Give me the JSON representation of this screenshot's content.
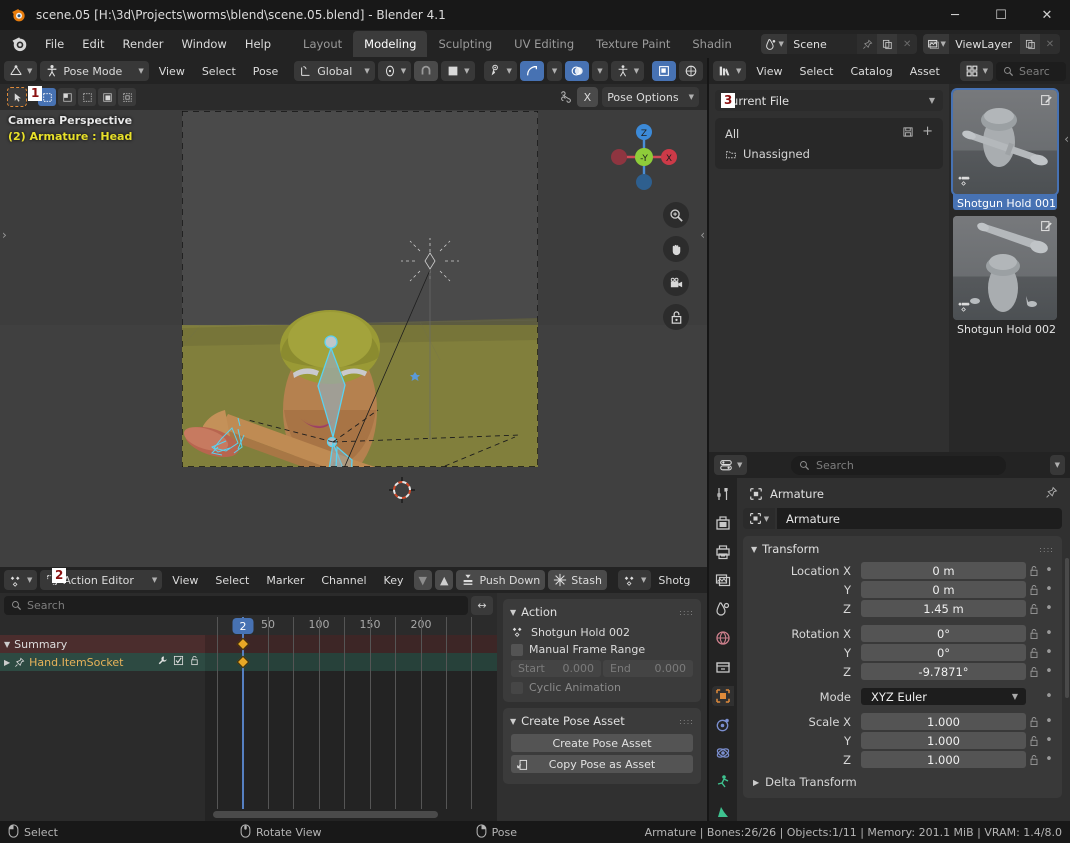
{
  "window": {
    "title": "scene.05 [H:\\3d\\Projects\\worms\\blend\\scene.05.blend] - Blender 4.1",
    "minimize": "─",
    "maximize": "☐",
    "close": "✕"
  },
  "menubar": {
    "items": [
      "File",
      "Edit",
      "Render",
      "Window",
      "Help"
    ],
    "workspaces": [
      {
        "label": "Layout",
        "active": false
      },
      {
        "label": "Modeling",
        "active": true
      },
      {
        "label": "Sculpting",
        "active": false
      },
      {
        "label": "UV Editing",
        "active": false
      },
      {
        "label": "Texture Paint",
        "active": false
      },
      {
        "label": "Shadin",
        "active": false
      }
    ],
    "scene_name": "Scene",
    "viewlayer_name": "ViewLayer"
  },
  "viewport": {
    "mode": "Pose Mode",
    "menus": [
      "View",
      "Select",
      "Pose"
    ],
    "transform_orientation": "Global",
    "pose_options": "Pose Options",
    "x_button": "X",
    "overlay_line1": "Camera Perspective",
    "overlay_line2": "(2) Armature : Head",
    "gizmo_axes": [
      "Z",
      "-Y",
      "X"
    ],
    "marker_1": "1"
  },
  "dopesheet": {
    "editor_mode": "Action Editor",
    "menus": [
      "View",
      "Select",
      "Marker",
      "Channel",
      "Key"
    ],
    "push_down": "Push Down",
    "stash": "Stash",
    "action_name_truncated": "Shotg",
    "search_placeholder": "Search",
    "ruler_ticks": [
      "50",
      "100",
      "150",
      "200"
    ],
    "current_frame": "2",
    "channels": [
      {
        "name": "Summary",
        "type": "summary"
      },
      {
        "name": "Hand.ItemSocket",
        "type": "channel"
      }
    ],
    "marker_2": "2",
    "sidebar": {
      "action_panel_title": "Action",
      "action_name": "Shotgun Hold 002",
      "manual_frame_range": "Manual Frame Range",
      "start_label": "Start",
      "start_value": "0.000",
      "end_label": "End",
      "end_value": "0.000",
      "cyclic_animation": "Cyclic Animation",
      "create_pose_asset_title": "Create Pose Asset",
      "create_pose_asset_button": "Create Pose Asset",
      "copy_pose_as_asset_button": "Copy Pose as Asset"
    }
  },
  "asset_browser": {
    "menus": [
      "View",
      "Select",
      "Catalog",
      "Asset"
    ],
    "search_placeholder": "Searc",
    "library": "Current File",
    "marker_3": "3",
    "catalogs": [
      "All",
      "Unassigned"
    ],
    "assets": [
      {
        "name": "Shotgun Hold 001",
        "selected": true
      },
      {
        "name": "Shotgun Hold 002",
        "selected": false
      }
    ]
  },
  "properties": {
    "search_placeholder": "Search",
    "breadcrumb": "Armature",
    "id_name": "Armature",
    "transform_title": "Transform",
    "rows": [
      {
        "label": "Location X",
        "value": "0 m",
        "type": "num"
      },
      {
        "label": "Y",
        "value": "0 m",
        "type": "num"
      },
      {
        "label": "Z",
        "value": "1.45 m",
        "type": "num"
      },
      {
        "label": "Rotation X",
        "value": "0°",
        "type": "num",
        "gap_before": true
      },
      {
        "label": "Y",
        "value": "0°",
        "type": "num"
      },
      {
        "label": "Z",
        "value": "-9.7871°",
        "type": "num"
      },
      {
        "label": "Mode",
        "value": "XYZ Euler",
        "type": "enum",
        "gap_before": true
      },
      {
        "label": "Scale X",
        "value": "1.000",
        "type": "num",
        "gap_before": true
      },
      {
        "label": "Y",
        "value": "1.000",
        "type": "num"
      },
      {
        "label": "Z",
        "value": "1.000",
        "type": "num"
      }
    ],
    "delta_transform": "Delta Transform"
  },
  "statusbar": {
    "left_items": [
      {
        "label": "Select",
        "mouse": "left"
      },
      {
        "label": "Rotate View",
        "mouse": "middle"
      },
      {
        "label": "Pose",
        "mouse": "right"
      }
    ],
    "right_text": "Armature | Bones:26/26 | Objects:1/11 | Memory: 201.1 MiB | VRAM: 1.4/8.0"
  },
  "colors": {
    "accent_blue": "#4772b3",
    "marker_red": "#8b1111",
    "keyframe_yellow": "#e8a826",
    "channel_text": "#e8b35a",
    "overlay_yellow": "#e8e02a"
  }
}
